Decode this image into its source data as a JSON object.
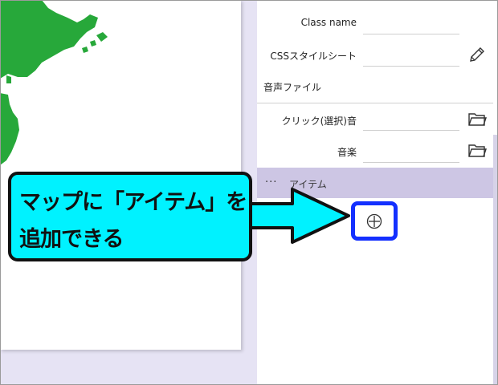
{
  "panel": {
    "class_name_label": "Class name",
    "css_label": "CSSスタイルシート",
    "sound_section": "音声ファイル",
    "click_sound_label": "クリック(選択)音",
    "music_label": "音楽"
  },
  "items": {
    "dots": "···",
    "title": "アイテム"
  },
  "callout": {
    "line1": "マップに「アイテム」を",
    "line2": "追加できる"
  },
  "colors": {
    "map_land": "#27a83a",
    "callout_bg": "#00f2ff",
    "highlight_border": "#1430ff",
    "items_header_bg": "#cdc6e4",
    "background": "#e6e3f4"
  },
  "icons": {
    "css_edit": "pencil-icon",
    "click_sound": "folder-icon",
    "music": "folder-icon",
    "add_item": "plus-circle-icon"
  }
}
